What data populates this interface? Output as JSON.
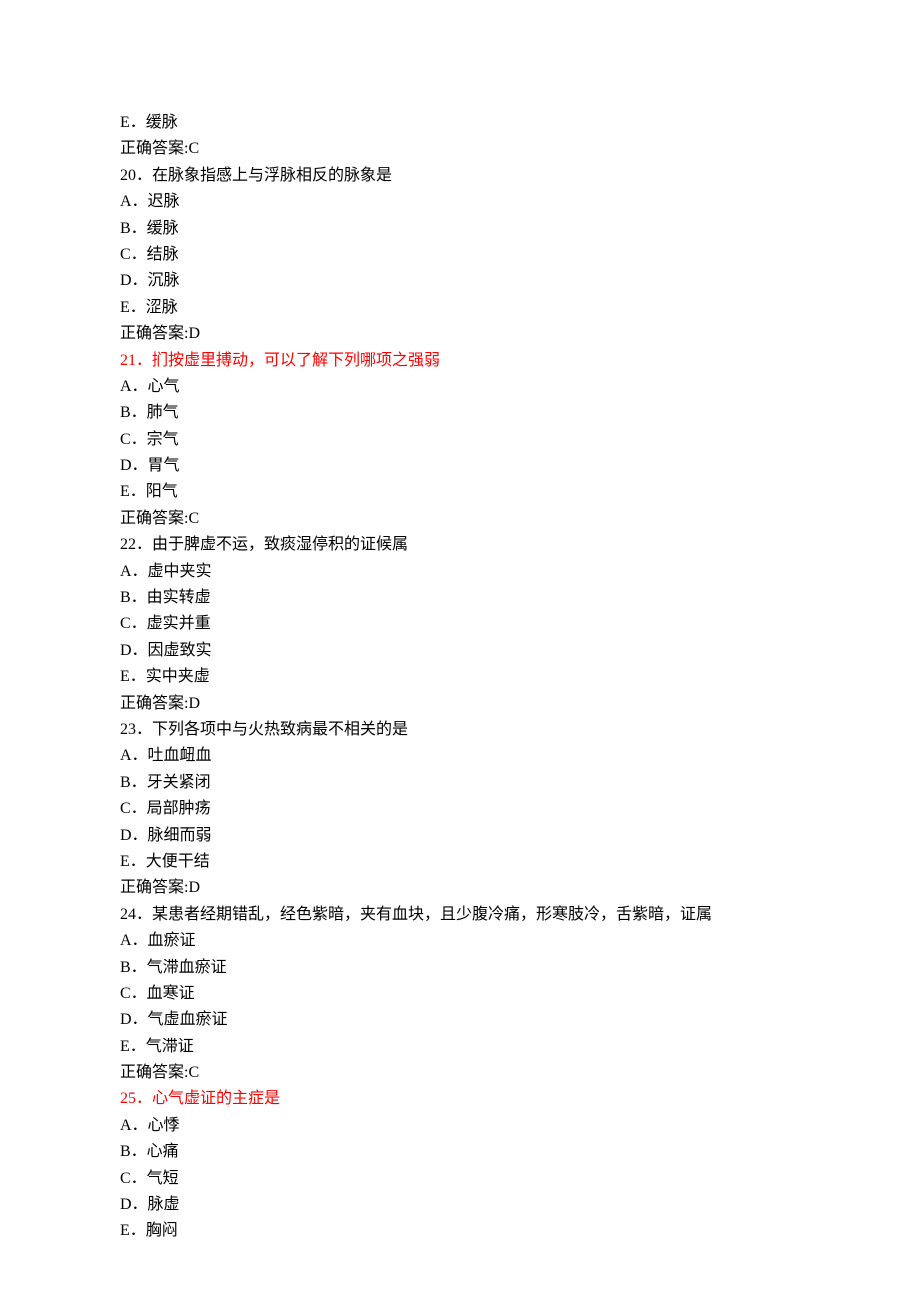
{
  "lines": [
    {
      "text": "E．缓脉",
      "red": false
    },
    {
      "text": "正确答案:C",
      "red": false
    },
    {
      "text": "20．在脉象指感上与浮脉相反的脉象是",
      "red": false
    },
    {
      "text": "A．迟脉",
      "red": false
    },
    {
      "text": "B．缓脉",
      "red": false
    },
    {
      "text": "C．结脉",
      "red": false
    },
    {
      "text": "D．沉脉",
      "red": false
    },
    {
      "text": "E．涩脉",
      "red": false
    },
    {
      "text": "正确答案:D",
      "red": false
    },
    {
      "text": "21．扪按虚里搏动，可以了解下列哪项之强弱",
      "red": true
    },
    {
      "text": "A．心气",
      "red": false
    },
    {
      "text": "B．肺气",
      "red": false
    },
    {
      "text": "C．宗气",
      "red": false
    },
    {
      "text": "D．胃气",
      "red": false
    },
    {
      "text": "E．阳气",
      "red": false
    },
    {
      "text": "正确答案:C",
      "red": false
    },
    {
      "text": "22．由于脾虚不运，致痰湿停积的证候属",
      "red": false
    },
    {
      "text": "A．虚中夹实",
      "red": false
    },
    {
      "text": "B．由实转虚",
      "red": false
    },
    {
      "text": "C．虚实并重",
      "red": false
    },
    {
      "text": "D．因虚致实",
      "red": false
    },
    {
      "text": "E．实中夹虚",
      "red": false
    },
    {
      "text": "正确答案:D",
      "red": false
    },
    {
      "text": "23．下列各项中与火热致病最不相关的是",
      "red": false
    },
    {
      "text": "A．吐血衄血",
      "red": false
    },
    {
      "text": "B．牙关紧闭",
      "red": false
    },
    {
      "text": "C．局部肿疡",
      "red": false
    },
    {
      "text": "D．脉细而弱",
      "red": false
    },
    {
      "text": "E．大便干结",
      "red": false
    },
    {
      "text": "正确答案:D",
      "red": false
    },
    {
      "text": "24．某患者经期错乱，经色紫暗，夹有血块，且少腹冷痛，形寒肢冷，舌紫暗，证属",
      "red": false
    },
    {
      "text": "A．血瘀证",
      "red": false
    },
    {
      "text": "B．气滞血瘀证",
      "red": false
    },
    {
      "text": "C．血寒证",
      "red": false
    },
    {
      "text": "D．气虚血瘀证",
      "red": false
    },
    {
      "text": "E．气滞证",
      "red": false
    },
    {
      "text": "正确答案:C",
      "red": false
    },
    {
      "text": "25．心气虚证的主症是",
      "red": true
    },
    {
      "text": "A．心悸",
      "red": false
    },
    {
      "text": "B．心痛",
      "red": false
    },
    {
      "text": "C．气短",
      "red": false
    },
    {
      "text": "D．脉虚",
      "red": false
    },
    {
      "text": "E．胸闷",
      "red": false
    }
  ]
}
